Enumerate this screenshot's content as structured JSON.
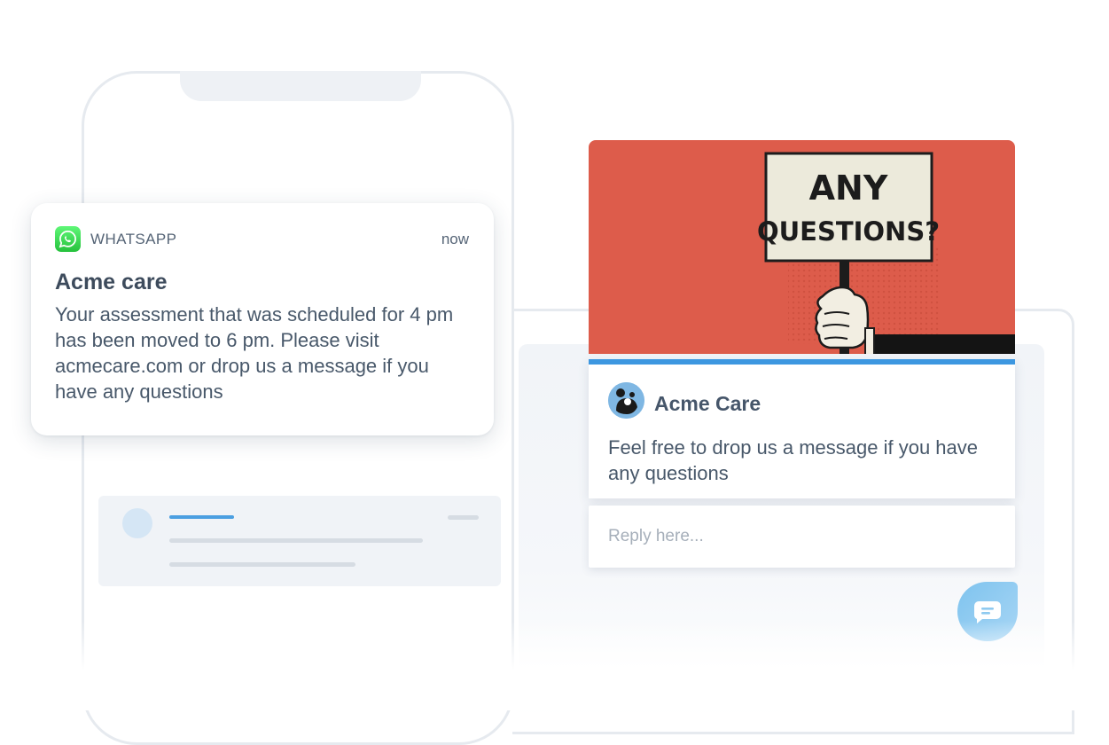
{
  "notification": {
    "app_name": "WHATSAPP",
    "time": "now",
    "title": "Acme care",
    "body": "Your assessment that was scheduled for 4 pm has been moved to 6 pm. Please visit acmecare.com or drop us a message if you have any questions",
    "icon": "whatsapp-icon"
  },
  "hero": {
    "sign_line1": "ANY",
    "sign_line2": "QUESTIONS?"
  },
  "chat": {
    "sender": "Acme Care",
    "message": "Feel free to drop us a message if you have any questions",
    "reply_placeholder": "Reply here...",
    "launcher_icon": "chat-bubble-icon"
  },
  "colors": {
    "accent_blue": "#3d97e0",
    "hero_red": "#dd5c4b",
    "whatsapp_green": "#25c13c",
    "launcher_blue": "#8fcaf0"
  }
}
